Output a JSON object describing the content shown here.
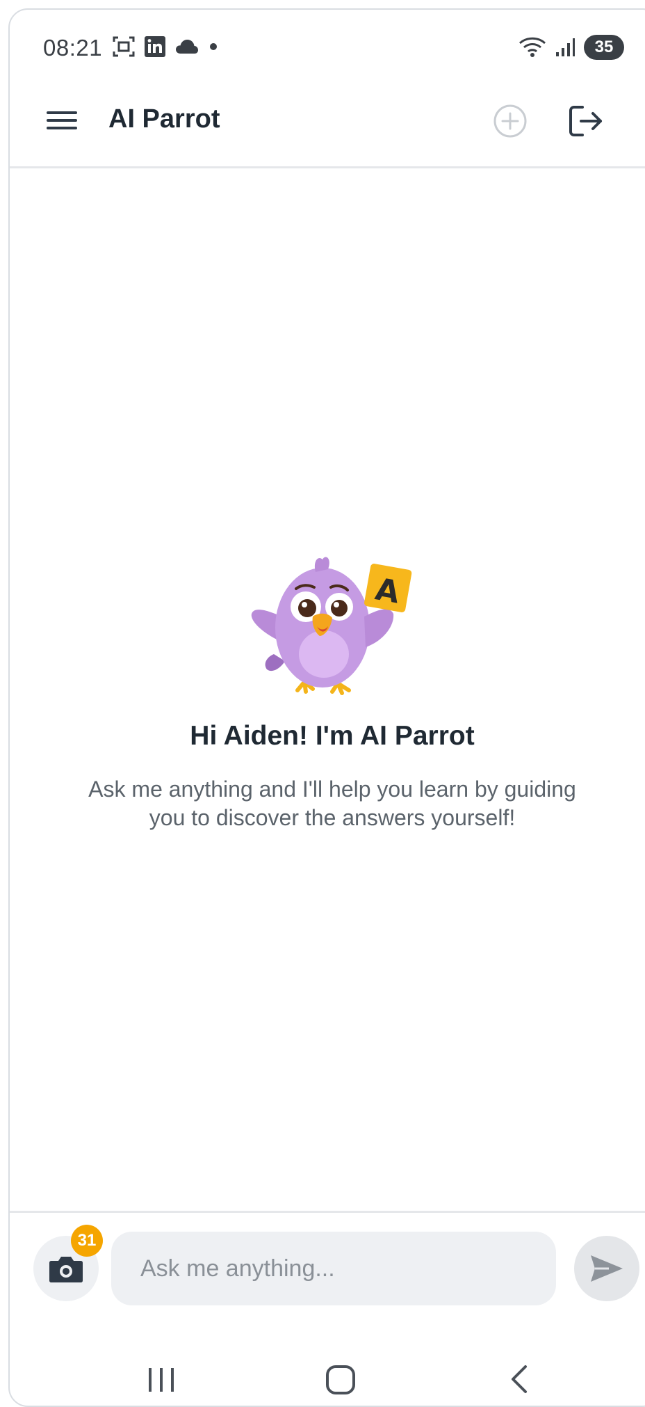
{
  "status_bar": {
    "time": "08:21",
    "battery": "35"
  },
  "app_bar": {
    "title": "AI Parrot"
  },
  "mascot": {
    "card_letter": "A"
  },
  "hero": {
    "title": "Hi Aiden! I'm AI Parrot",
    "subtitle": "Ask me anything and I'll help you learn by guiding you to discover the answers yourself!"
  },
  "composer": {
    "camera_badge": "31",
    "input_placeholder": "Ask me anything...",
    "input_value": ""
  },
  "colors": {
    "accent_badge": "#f5a500",
    "parrot_purple": "#c59be3",
    "input_bg": "#eef0f3"
  },
  "icons": [
    "menu-icon",
    "add-circle-icon",
    "logout-icon",
    "camera-icon",
    "send-icon",
    "recent-apps-icon",
    "home-icon",
    "back-icon"
  ]
}
